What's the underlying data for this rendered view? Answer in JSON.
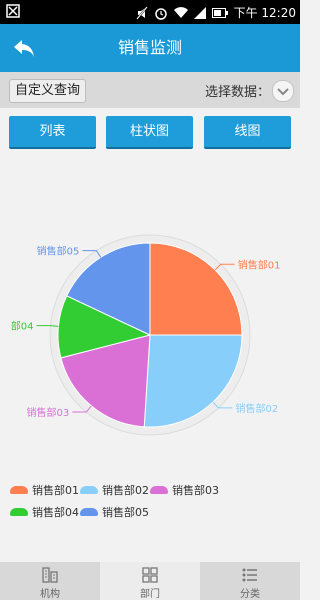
{
  "status_bar": {
    "time": "下午 12:20"
  },
  "header": {
    "title": "销售监测",
    "back_icon": "back-arrow-icon"
  },
  "filter": {
    "custom_query": "自定义查询",
    "select_label": "选择数据：",
    "select_icon": "chevron-down-icon"
  },
  "tabs": [
    {
      "label": "列表"
    },
    {
      "label": "柱状图"
    },
    {
      "label": "线图"
    }
  ],
  "chart_data": {
    "type": "pie",
    "categories": [
      "销售部01",
      "销售部02",
      "销售部03",
      "销售部04",
      "销售部05"
    ],
    "values": [
      25,
      26,
      20,
      11,
      18
    ],
    "colors": [
      "#ff7f50",
      "#87cefa",
      "#da70d6",
      "#32cd32",
      "#6495ed"
    ],
    "outer_labels": [
      "销售部01",
      "销售部02",
      "销售部03",
      "部04",
      "销售部05"
    ],
    "legend": "bottom"
  },
  "bottom_nav": [
    {
      "label": "机构",
      "icon": "building-icon"
    },
    {
      "label": "部门",
      "icon": "grid-icon"
    },
    {
      "label": "分类",
      "icon": "list-icon"
    }
  ]
}
